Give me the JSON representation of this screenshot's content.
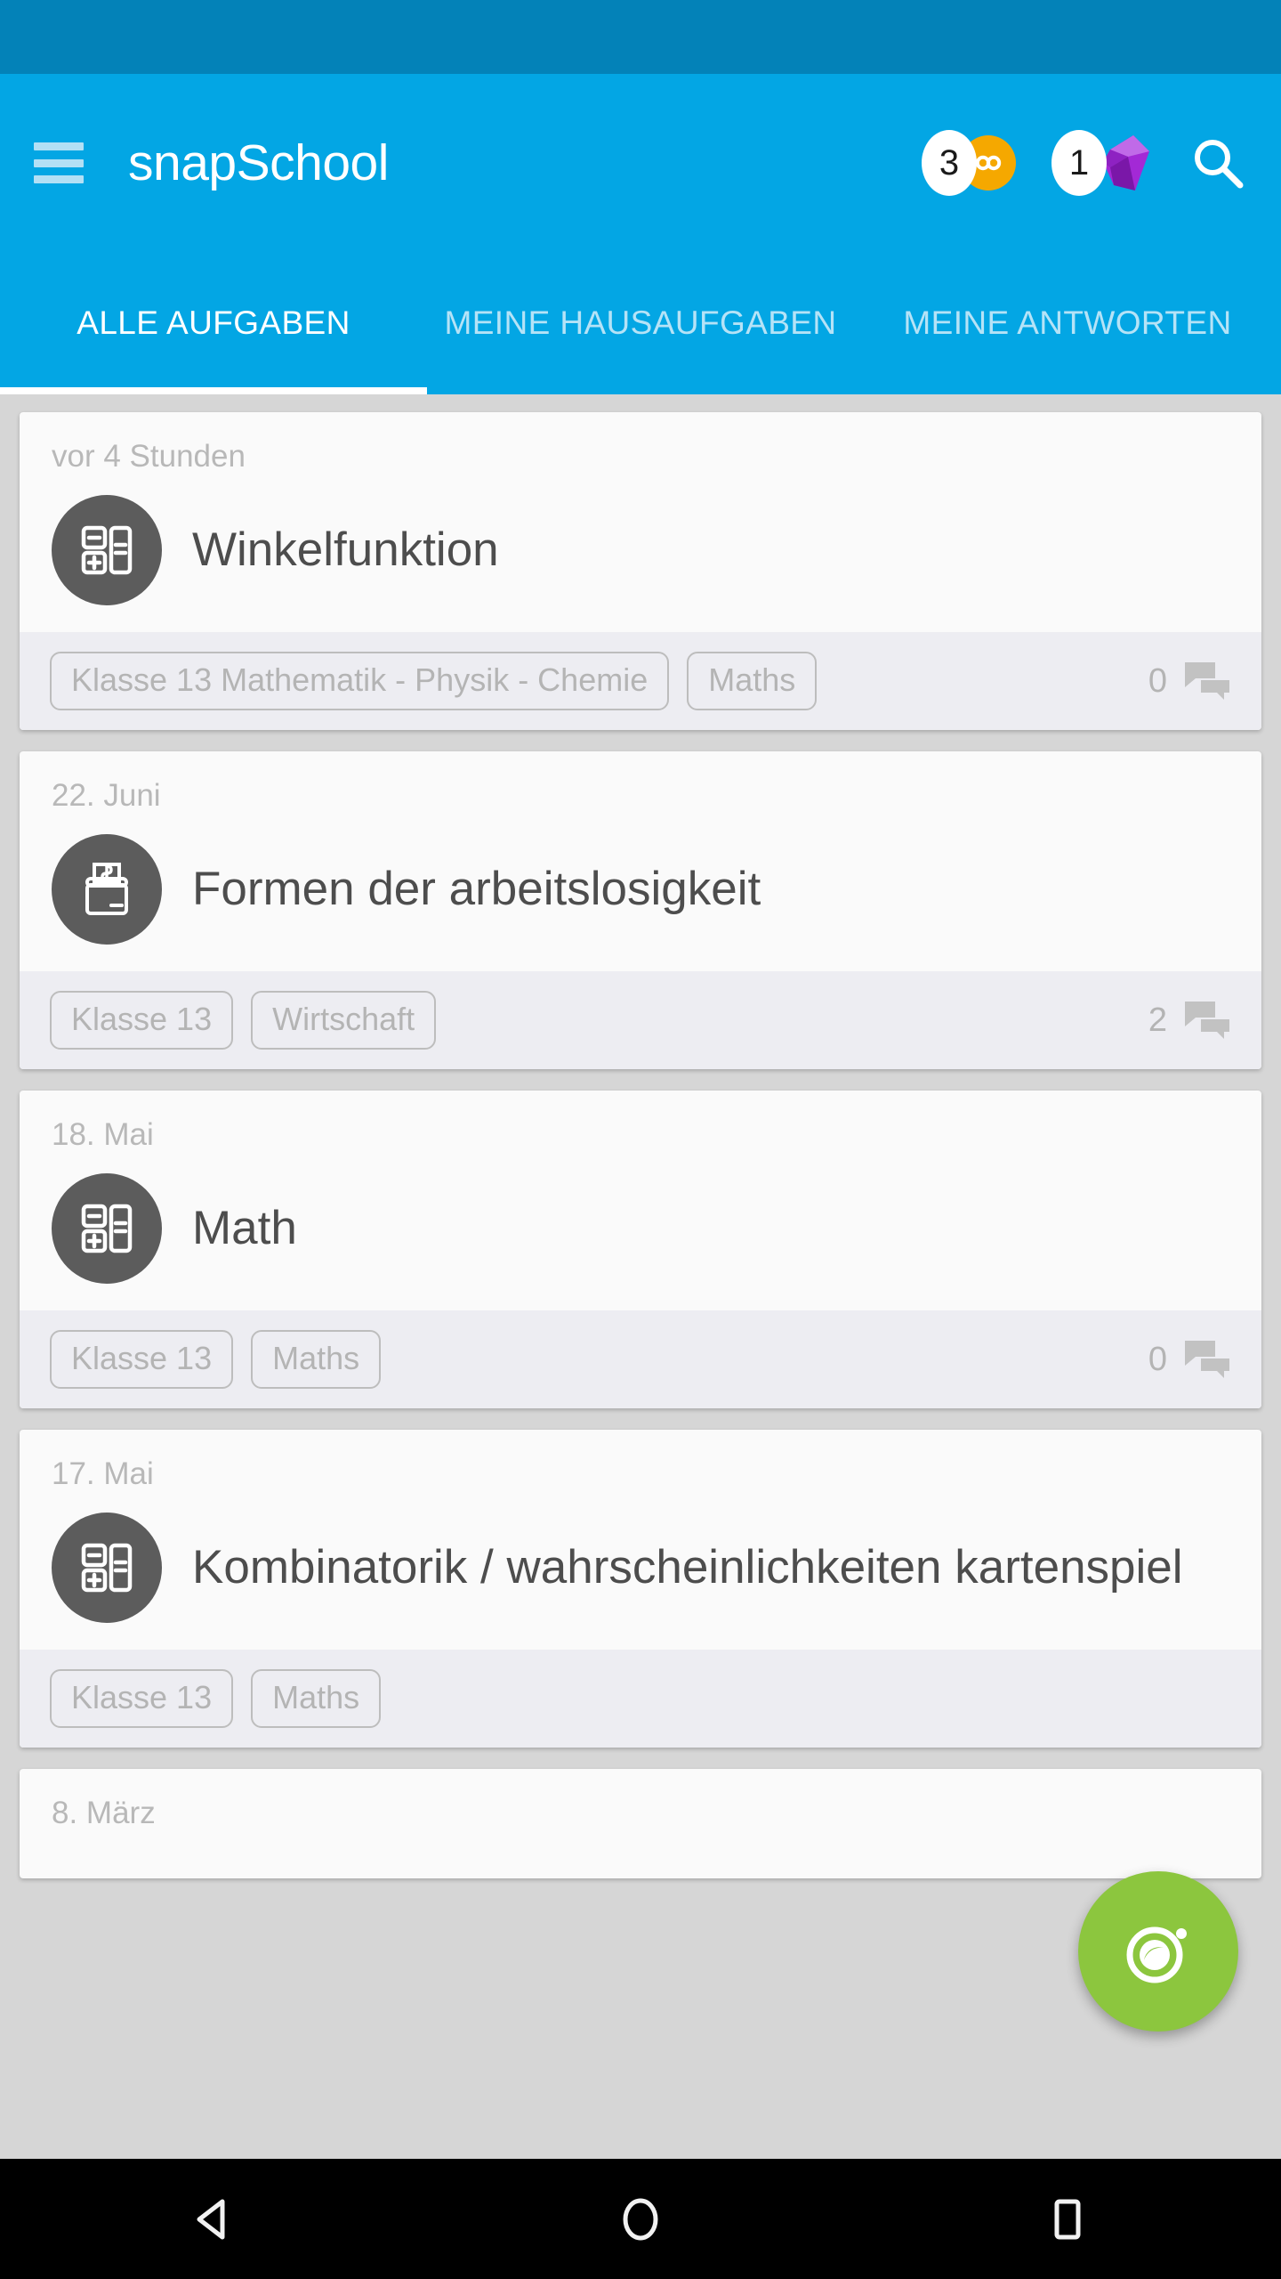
{
  "app": {
    "title": "snapSchool",
    "menu_icon": "hamburger-menu-icon",
    "search_icon": "search-icon"
  },
  "badges": [
    {
      "count": "3",
      "icon": "infinity-coin-icon",
      "color": "#F5A800"
    },
    {
      "count": "1",
      "icon": "gem-crystal-icon",
      "color": "#A329D6"
    }
  ],
  "tabs": [
    {
      "label": "ALLE AUFGABEN",
      "active": true
    },
    {
      "label": "MEINE HAUSAUFGABEN",
      "active": false
    },
    {
      "label": "MEINE ANTWORTEN",
      "active": false
    }
  ],
  "cards": [
    {
      "date": "vor 4 Stunden",
      "title": "Winkelfunktion",
      "icon": "math-calculator-icon",
      "chips": [
        "Klasse 13 Mathematik - Physik - Chemie",
        "Maths"
      ],
      "comments": "0"
    },
    {
      "date": "22. Juni",
      "title": "Formen der arbeitslosigkeit",
      "icon": "wallet-money-icon",
      "chips": [
        "Klasse 13",
        "Wirtschaft"
      ],
      "comments": "2"
    },
    {
      "date": "18. Mai",
      "title": "Math",
      "icon": "math-calculator-icon",
      "chips": [
        "Klasse 13",
        "Maths"
      ],
      "comments": "0"
    },
    {
      "date": "17. Mai",
      "title": "Kombinatorik / wahrscheinlichkeiten kartenspiel",
      "icon": "math-calculator-icon",
      "chips": [
        "Klasse 13",
        "Maths"
      ],
      "comments": ""
    },
    {
      "date": "8. März",
      "title": "",
      "icon": "",
      "chips": [],
      "comments": ""
    }
  ],
  "fab": {
    "icon": "camera-lens-icon",
    "color": "#8CC63E"
  },
  "navbar": {
    "back": "back-triangle-icon",
    "home": "home-circle-icon",
    "recents": "recents-square-icon"
  },
  "colors": {
    "status_bar": "#0382B8",
    "app_bar": "#03A6E4",
    "tab_inactive": "#B5E3F7",
    "card_bg": "#FAFAFA",
    "card_footer": "#EDEDF2",
    "avatar": "#5C5C5C",
    "accent_green": "#8CC63E"
  }
}
